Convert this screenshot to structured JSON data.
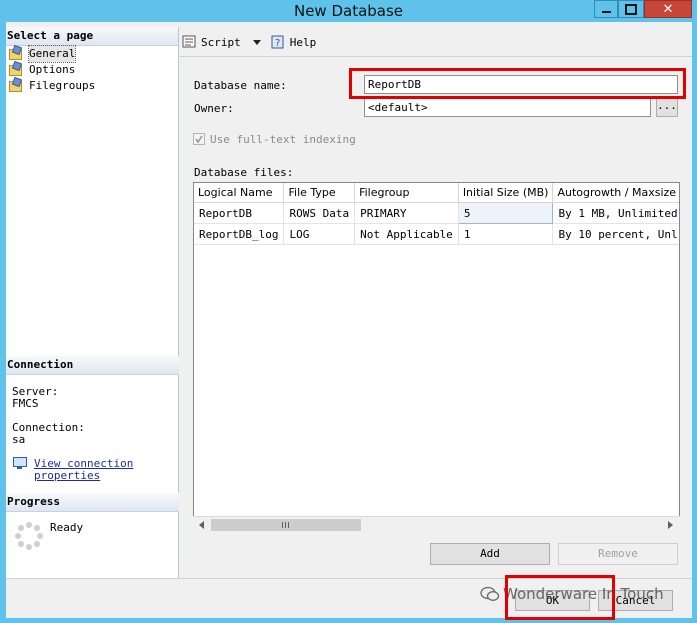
{
  "window": {
    "title": "New Database",
    "minimize_icon": "minimize-icon",
    "maximize_icon": "maximize-icon",
    "close_icon": "close-icon"
  },
  "left_panel": {
    "select_page_header": "Select a page",
    "pages": [
      {
        "label": "General",
        "selected": true
      },
      {
        "label": "Options",
        "selected": false
      },
      {
        "label": "Filegroups",
        "selected": false
      }
    ],
    "connection_header": "Connection",
    "server_label": "Server:",
    "server_value": "FMCS",
    "connection_label": "Connection:",
    "connection_value": "sa",
    "view_connection_link_line1": "View connection",
    "view_connection_link_line2": "properties",
    "progress_header": "Progress",
    "progress_status": "Ready"
  },
  "toolbar": {
    "script_label": "Script",
    "help_label": "Help"
  },
  "general": {
    "database_name_label": "Database name:",
    "database_name_value": "ReportDB",
    "owner_label": "Owner:",
    "owner_value": "<default>",
    "browse_button": "...",
    "fulltext_label": "Use full-text indexing",
    "fulltext_checked": true,
    "database_files_label": "Database files:"
  },
  "files_table": {
    "columns": [
      "Logical Name",
      "File Type",
      "Filegroup",
      "Initial Size (MB)",
      "Autogrowth / Maxsize"
    ],
    "rows": [
      [
        "ReportDB",
        "ROWS Data",
        "PRIMARY",
        "5",
        "By 1 MB, Unlimited"
      ],
      [
        "ReportDB_log",
        "LOG",
        "Not Applicable",
        "1",
        "By 10 percent, Unl"
      ]
    ]
  },
  "buttons": {
    "add": "Add",
    "remove": "Remove",
    "ok": "OK",
    "cancel": "Cancel"
  },
  "watermark": "Wonderware In Touch",
  "colors": {
    "accent": "#5ec2ea",
    "highlight_red": "#e40000"
  }
}
